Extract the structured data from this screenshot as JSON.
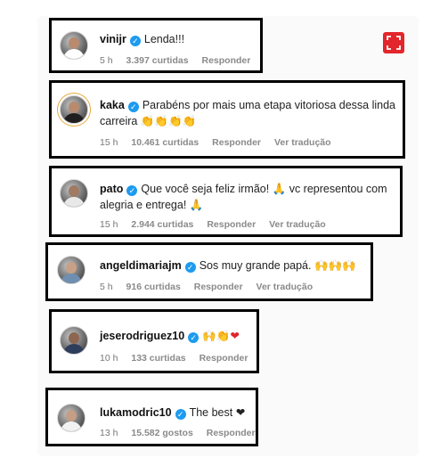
{
  "comments": [
    {
      "username": "vinijr",
      "text": "Lenda!!!",
      "time": "5 h",
      "likes": "3.397 curtidas",
      "reply": "Responder",
      "translate": ""
    },
    {
      "username": "kaka",
      "text": "Parabéns por mais uma etapa vitoriosa dessa linda",
      "text2": "carreira 👏👏👏👏",
      "time": "15 h",
      "likes": "10.461 curtidas",
      "reply": "Responder",
      "translate": "Ver tradução"
    },
    {
      "username": "pato",
      "text": "Que você seja feliz irmão! 🙏 vc representou com",
      "text2": "alegria e entrega! 🙏",
      "time": "15 h",
      "likes": "2.944 curtidas",
      "reply": "Responder",
      "translate": "Ver tradução"
    },
    {
      "username": "angeldimariajm",
      "text": "Sos muy grande papá. 🙌🙌🙌",
      "time": "5 h",
      "likes": "916 curtidas",
      "reply": "Responder",
      "translate": "Ver tradução"
    },
    {
      "username": "jeserodriguez10",
      "text": "🙌👏❤",
      "time": "10 h",
      "likes": "133 curtidas",
      "reply": "Responder"
    },
    {
      "username": "lukamodric10",
      "text": "The best ❤",
      "time": "13 h",
      "likes": "15.582 gostos",
      "reply": "Responder"
    }
  ],
  "verified_symbol": "✓",
  "icons": {
    "expand": "expand-icon"
  },
  "colors": {
    "accent": "#e3262b",
    "verified": "#1d9bf0",
    "box_border": "#000000"
  }
}
